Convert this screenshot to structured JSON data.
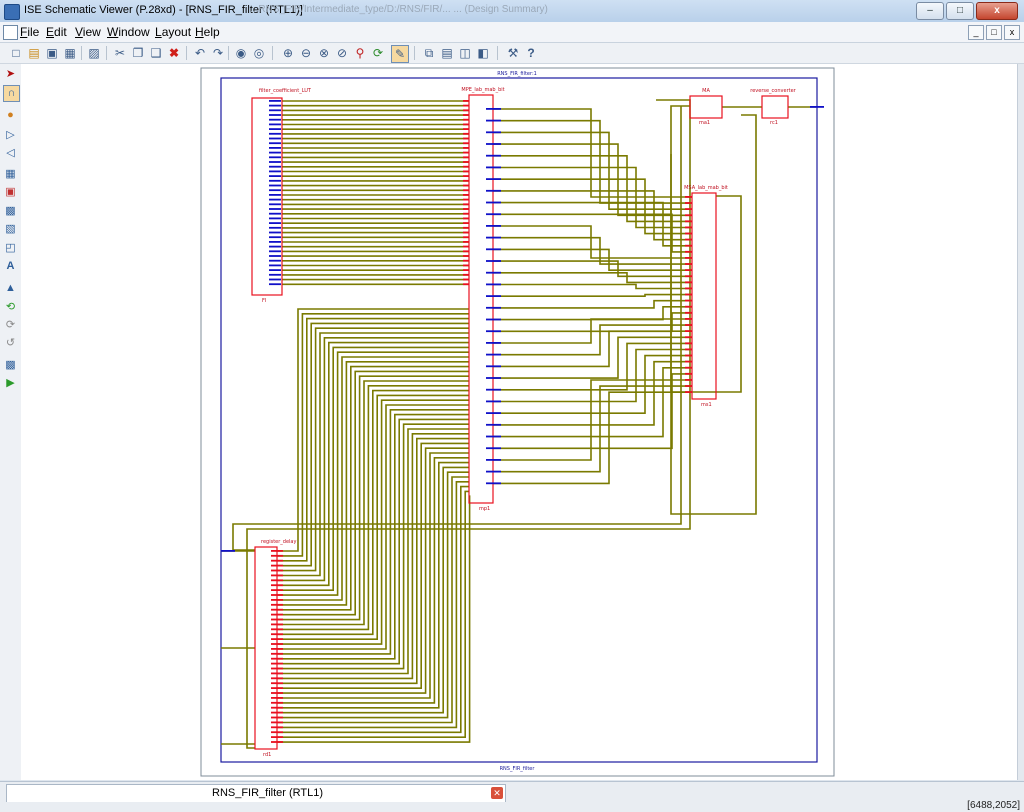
{
  "window": {
    "title": "ISE Schematic Viewer (P.28xd) - [RNS_FIR_filter (RTL1)]",
    "background_title": "...RNS_FIR/Intermediate_type/D:/RNS/FIR/...  ... (Design Summary)",
    "buttons": {
      "minimize": "‒",
      "maximize": "□",
      "close": "x"
    }
  },
  "menu": {
    "items": [
      {
        "label": "File",
        "key": "F"
      },
      {
        "label": "Edit",
        "key": "E"
      },
      {
        "label": "View",
        "key": "V"
      },
      {
        "label": "Window",
        "key": "W"
      },
      {
        "label": "Layout",
        "key": "L"
      },
      {
        "label": "Help",
        "key": "H"
      }
    ]
  },
  "toolbar": {
    "icons": [
      "new-icon",
      "open-icon",
      "save-icon",
      "save-all-icon",
      "print-icon",
      "cut-icon",
      "copy-icon",
      "paste-icon",
      "delete-icon",
      "undo-icon",
      "redo-icon",
      "find-icon",
      "find-next-icon",
      "zoom-in-icon",
      "zoom-out-icon",
      "zoom-full-icon",
      "zoom-area-icon",
      "zoom-to-selected-icon",
      "refresh-icon",
      "select-mode-icon",
      "cascade-icon",
      "tile-horizontal-icon",
      "tile-vertical-icon",
      "tile-window-icon",
      "settings-icon",
      "help-icon"
    ]
  },
  "leftbar": {
    "icons": [
      "select-arrow-icon",
      "add-wire-icon",
      "add-net-icon",
      "forward-icon",
      "back-icon",
      "hierarchy-icon",
      "add-pin-icon",
      "instance-icon",
      "bus-icon",
      "io-marker-icon",
      "text-icon",
      "push-icon",
      "pop-icon",
      "go-back-icon",
      "go-forward-icon",
      "undo-view-icon",
      "expand-icon",
      "run-icon"
    ]
  },
  "schematic": {
    "top_title": "RNS_FIR_filter:1",
    "bottom_title": "RNS_FIR_filter",
    "blocks": {
      "lut": {
        "title": "filter_coefficient_LUT",
        "instance": "FI"
      },
      "mpe": {
        "title": "MPE_lab_mab_bit",
        "instance": "mp1"
      },
      "ma": {
        "title": "MA",
        "instance": "ma1"
      },
      "rc": {
        "title": "reverse_converter",
        "instance": "rc1"
      },
      "msa": {
        "title": "MSA_lab_mab_bit",
        "instance": "ms1"
      },
      "rd": {
        "title": "register_delay",
        "instance": "rd1"
      }
    }
  },
  "tabs": [
    {
      "label": "RNS_FIR_filter (RTL1)",
      "close": "✕"
    }
  ],
  "status": {
    "coords": "[6488,2052]"
  },
  "colors": {
    "wire": "#7a7a00",
    "border": "#1a1aa0",
    "block": "#e8101f",
    "pin": "#1010c8"
  }
}
